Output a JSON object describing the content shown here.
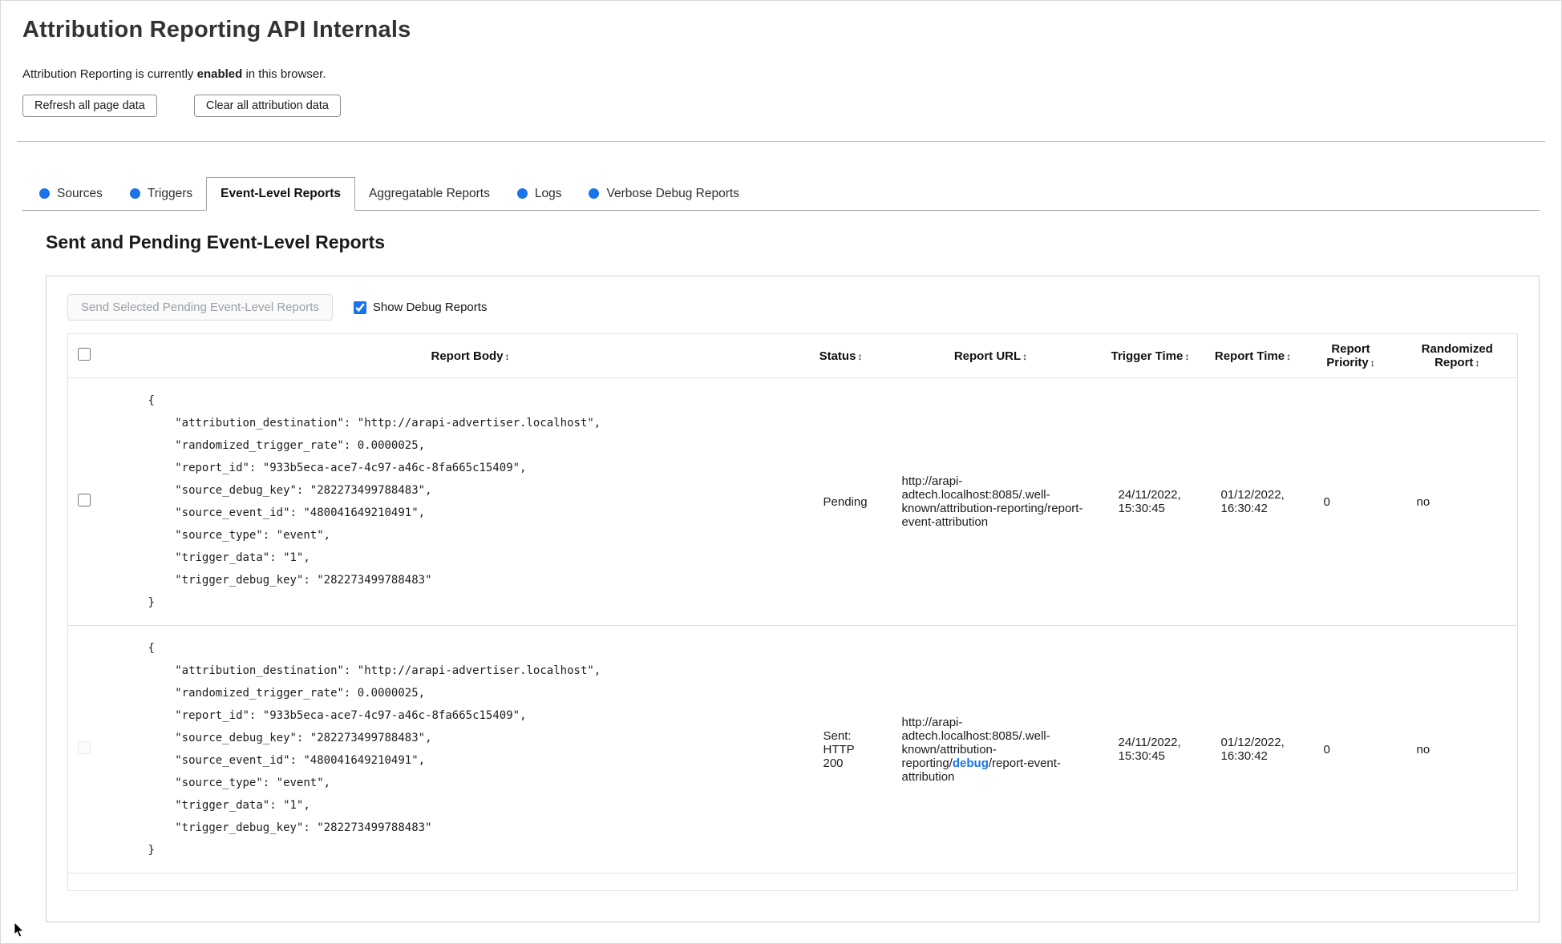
{
  "colors": {
    "accent_blue": "#1a73e8"
  },
  "page": {
    "title": "Attribution Reporting API Internals",
    "status_prefix": "Attribution Reporting is currently ",
    "status_emphasis": "enabled",
    "status_suffix": " in this browser.",
    "refresh_button": "Refresh all page data",
    "clear_button": "Clear all attribution data"
  },
  "tabs": {
    "items": [
      {
        "label": "Sources",
        "has_dot": true,
        "active": false
      },
      {
        "label": "Triggers",
        "has_dot": true,
        "active": false
      },
      {
        "label": "Event-Level Reports",
        "has_dot": false,
        "active": true
      },
      {
        "label": "Aggregatable Reports",
        "has_dot": false,
        "active": false
      },
      {
        "label": "Logs",
        "has_dot": true,
        "active": false
      },
      {
        "label": "Verbose Debug Reports",
        "has_dot": true,
        "active": false
      }
    ]
  },
  "section": {
    "heading": "Sent and Pending Event-Level Reports",
    "send_button": "Send Selected Pending Event-Level Reports",
    "send_button_enabled": false,
    "show_debug_label": "Show Debug Reports",
    "show_debug_checked": true
  },
  "table": {
    "sort_icon": "↕",
    "headers": {
      "report_body": "Report Body",
      "status": "Status",
      "report_url": "Report URL",
      "trigger_time": "Trigger Time",
      "report_time": "Report Time",
      "report_priority": "Report Priority",
      "randomized_report": "Randomized Report"
    },
    "rows": [
      {
        "report_body": "{\n    \"attribution_destination\": \"http://arapi-advertiser.localhost\",\n    \"randomized_trigger_rate\": 0.0000025,\n    \"report_id\": \"933b5eca-ace7-4c97-a46c-8fa665c15409\",\n    \"source_debug_key\": \"282273499788483\",\n    \"source_event_id\": \"480041649210491\",\n    \"source_type\": \"event\",\n    \"trigger_data\": \"1\",\n    \"trigger_debug_key\": \"282273499788483\"\n}",
        "status": "Pending",
        "url_prefix": "http://arapi-adtech.localhost:8085/.well-known/attribution-reporting/report-event-attribution",
        "url_debug": "",
        "url_suffix": "",
        "trigger_time": "24/11/2022, 15:30:45",
        "report_time": "01/12/2022, 16:30:42",
        "report_priority": "0",
        "randomized_report": "no",
        "checkbox_enabled": true
      },
      {
        "report_body": "{\n    \"attribution_destination\": \"http://arapi-advertiser.localhost\",\n    \"randomized_trigger_rate\": 0.0000025,\n    \"report_id\": \"933b5eca-ace7-4c97-a46c-8fa665c15409\",\n    \"source_debug_key\": \"282273499788483\",\n    \"source_event_id\": \"480041649210491\",\n    \"source_type\": \"event\",\n    \"trigger_data\": \"1\",\n    \"trigger_debug_key\": \"282273499788483\"\n}",
        "status": "Sent: HTTP 200",
        "url_prefix": "http://arapi-adtech.localhost:8085/.well-known/attribution-reporting/",
        "url_debug": "debug",
        "url_suffix": "/report-event-attribution",
        "trigger_time": "24/11/2022, 15:30:45",
        "report_time": "01/12/2022, 16:30:42",
        "report_priority": "0",
        "randomized_report": "no",
        "checkbox_enabled": false
      }
    ]
  }
}
